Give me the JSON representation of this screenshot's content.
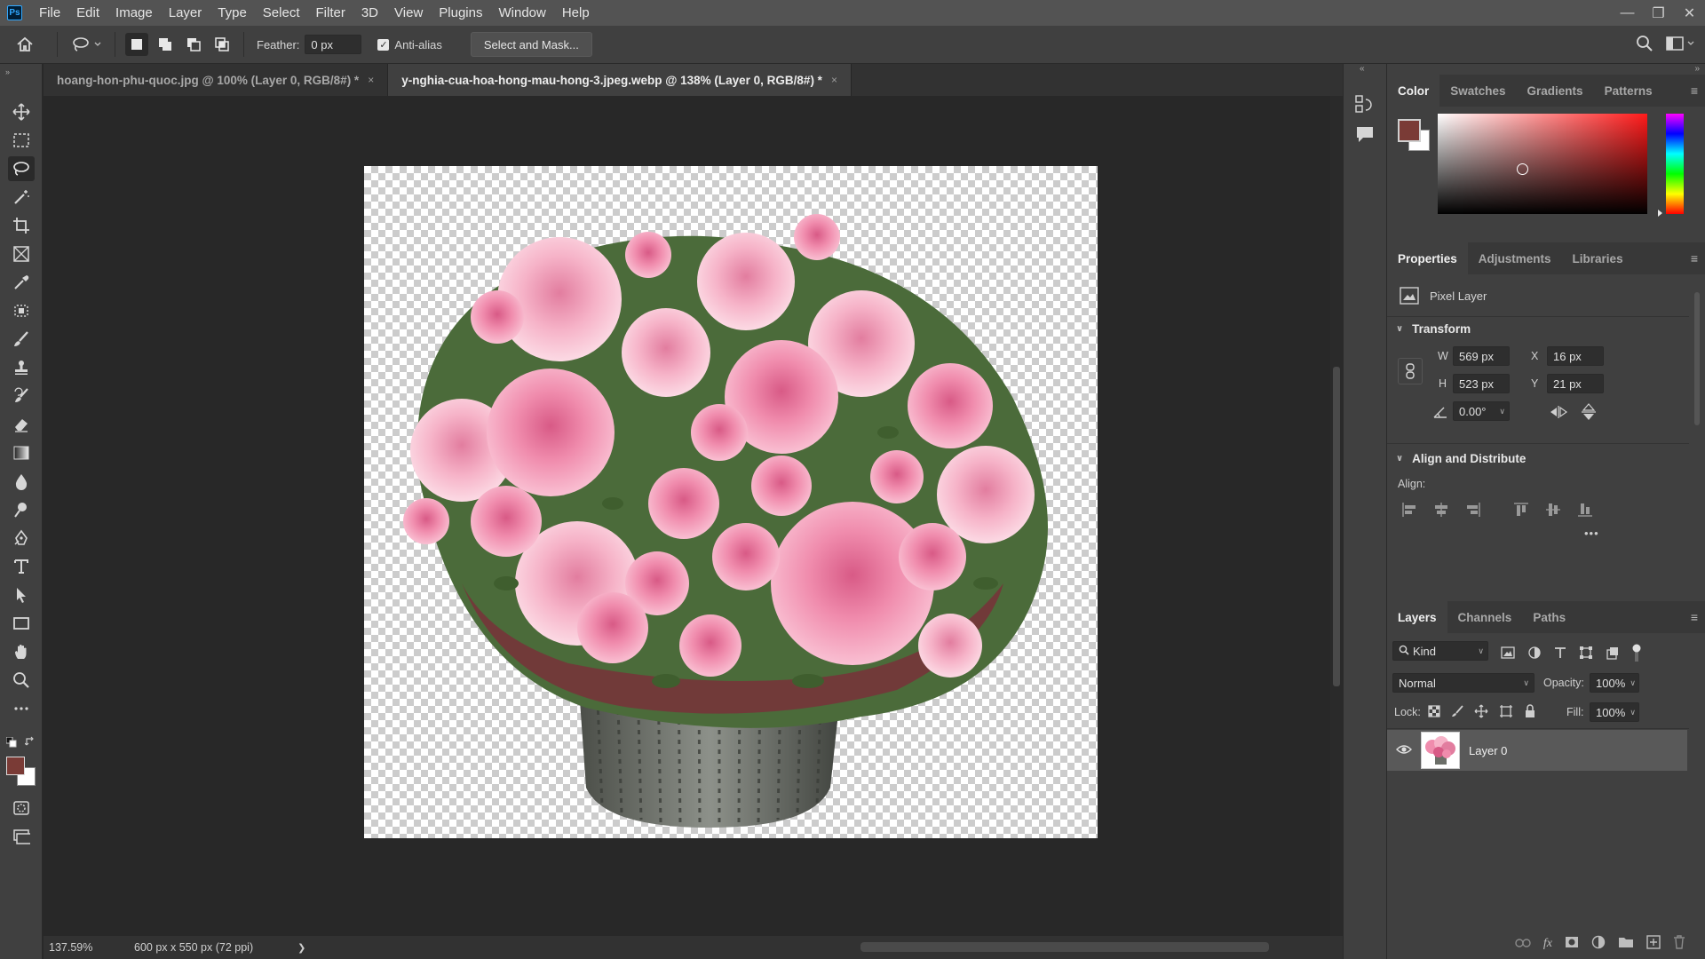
{
  "app": {
    "logo": "Ps"
  },
  "menu": [
    "File",
    "Edit",
    "Image",
    "Layer",
    "Type",
    "Select",
    "Filter",
    "3D",
    "View",
    "Plugins",
    "Window",
    "Help"
  ],
  "options": {
    "feather_label": "Feather:",
    "feather_value": "0 px",
    "antialias_label": "Anti-alias",
    "select_mask_label": "Select and Mask..."
  },
  "tabs": [
    {
      "label": "hoang-hon-phu-quoc.jpg @ 100% (Layer 0, RGB/8#) *",
      "close": "×"
    },
    {
      "label": "y-nghia-cua-hoa-hong-mau-hong-3.jpeg.webp @ 138% (Layer 0, RGB/8#) *",
      "close": "×"
    }
  ],
  "status": {
    "zoom": "137.59%",
    "doc_info": "600 px x 550 px (72 ppi)",
    "arrow": "❯"
  },
  "color_panel": {
    "tabs": [
      "Color",
      "Swatches",
      "Gradients",
      "Patterns"
    ],
    "foreground": "#7a3b36",
    "background": "#ffffff",
    "hue": "#ff1a1a"
  },
  "properties_panel": {
    "tabs": [
      "Properties",
      "Adjustments",
      "Libraries"
    ],
    "layer_type": "Pixel Layer",
    "transform_title": "Transform",
    "w_label": "W",
    "w_value": "569 px",
    "h_label": "H",
    "h_value": "523 px",
    "x_label": "X",
    "x_value": "16 px",
    "y_label": "Y",
    "y_value": "21 px",
    "angle_value": "0.00°",
    "align_title": "Align and Distribute",
    "align_label": "Align:",
    "more": "•••"
  },
  "layers_panel": {
    "tabs": [
      "Layers",
      "Channels",
      "Paths"
    ],
    "filter_kind": "Kind",
    "blend_mode": "Normal",
    "opacity_label": "Opacity:",
    "opacity_value": "100%",
    "lock_label": "Lock:",
    "fill_label": "Fill:",
    "fill_value": "100%",
    "layer_name": "Layer 0"
  },
  "colors": {
    "ui_dark": "#282828",
    "ui_panel": "#404040",
    "menubar": "#535353",
    "accent": "#31a8ff"
  }
}
